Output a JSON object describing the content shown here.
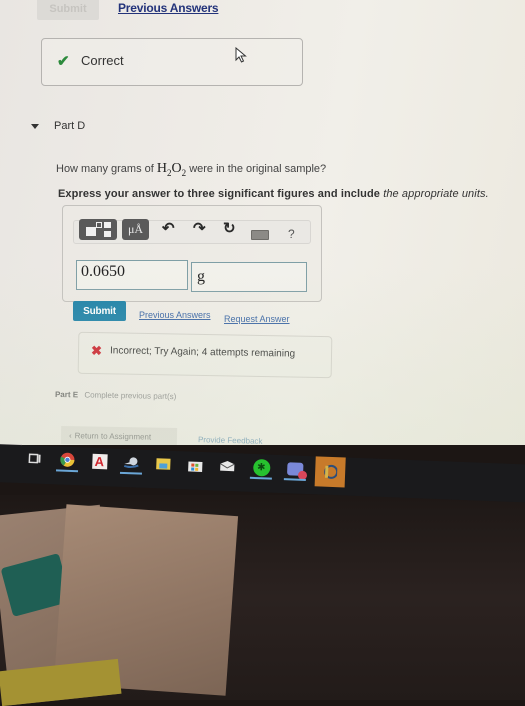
{
  "previous_part": {
    "submit_label": "Submit",
    "previous_answers_label": "Previous Answers",
    "feedback": {
      "icon": "check-icon",
      "text": "Correct",
      "status_color": "#2c8a3c"
    }
  },
  "part_d": {
    "title": "Part D",
    "expanded": true,
    "question_prefix": "How many grams of",
    "formula": {
      "e1": "H",
      "s1": "2",
      "e2": "O",
      "s2": "2"
    },
    "question_suffix": "were in the original sample?",
    "instruction_bold": "Express your answer to three significant figures and include",
    "instruction_italic": "the appropriate units.",
    "toolbar": {
      "template_icon": "templates-icon",
      "units_label": "μÅ",
      "undo_icon": "undo-icon",
      "redo_icon": "redo-icon",
      "reset_icon": "reset-icon",
      "keyboard_icon": "keyboard-icon",
      "help_label": "?"
    },
    "value_input": "0.0650",
    "unit_input": "g",
    "submit_label": "Submit",
    "previous_answers_label": "Previous Answers",
    "request_answer_label": "Request Answer",
    "feedback": {
      "icon": "x-icon",
      "text": "Incorrect; Try Again; 4 attempts remaining",
      "status_color": "#cc1f2b"
    }
  },
  "part_e": {
    "title": "Part E",
    "status": "Complete previous part(s)"
  },
  "footer": {
    "return_label": "Return to Assignment",
    "feedback_label": "Provide Feedback"
  },
  "colors": {
    "submit_button": "#1f82a8",
    "link": "#3b66a6",
    "input_border": "#7f9fa6"
  },
  "taskbar": {
    "items": [
      {
        "name": "task-view",
        "active": false
      },
      {
        "name": "chrome",
        "active": true
      },
      {
        "name": "acrobat",
        "active": false
      },
      {
        "name": "steam",
        "active": true
      },
      {
        "name": "file-explorer",
        "active": false
      },
      {
        "name": "microsoft-store",
        "active": false
      },
      {
        "name": "mail",
        "active": false
      },
      {
        "name": "razer",
        "active": true
      },
      {
        "name": "discord",
        "active": true
      },
      {
        "name": "league-of-legends",
        "active": false
      }
    ]
  }
}
